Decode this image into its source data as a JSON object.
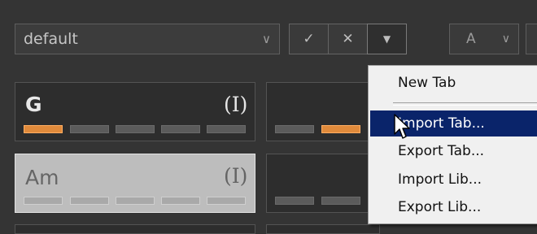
{
  "toolbar": {
    "preset_value": "default",
    "preset_chevron": "chevron-down-icon",
    "confirm_icon": "✓",
    "cancel_icon": "✕",
    "dropdown_icon": "▼",
    "key_value": "A",
    "key_chevron": "chevron-down-icon"
  },
  "chords": [
    {
      "name": "G",
      "mode": "(I)",
      "active": false,
      "segments": [
        "orange",
        "gray",
        "gray",
        "gray",
        "gray"
      ]
    },
    {
      "name": "Am",
      "mode": "(I)",
      "active": true,
      "segments": [
        "gray",
        "red",
        "gray",
        "gray",
        "gray"
      ]
    }
  ],
  "second_column": {
    "row1_segments": [
      "gray",
      "orange"
    ],
    "row2_segments": [
      "gray",
      "gray"
    ]
  },
  "menu": {
    "items": [
      "New Tab",
      "Import Tab...",
      "Export Tab...",
      "Import Lib...",
      "Export Lib..."
    ],
    "highlighted": "Import Tab..."
  },
  "colors": {
    "background": "#343434",
    "highlight": "#0a246a",
    "orange_segment": "#e08a3b",
    "red_segment": "#d40000"
  }
}
